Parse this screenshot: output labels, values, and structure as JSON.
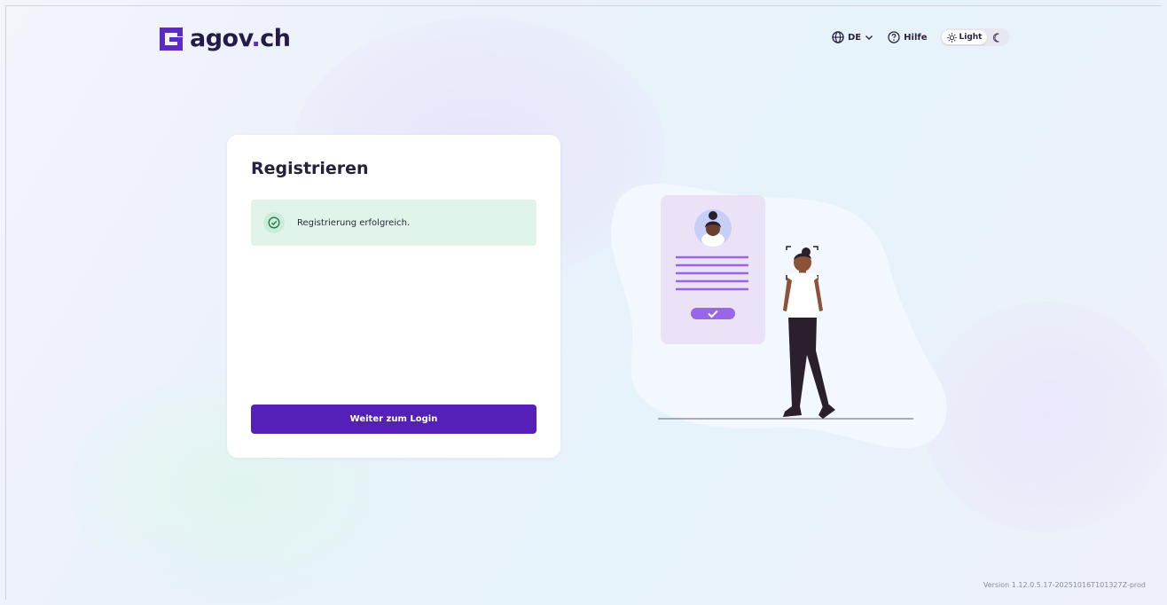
{
  "header": {
    "logo_text_main": "agov",
    "logo_text_dot": ".",
    "logo_text_tld": "ch",
    "language": "DE",
    "help_label": "Hilfe",
    "theme_light_label": "Light"
  },
  "card": {
    "title": "Registrieren",
    "alert_message": "Registrierung erfolgreich.",
    "primary_button": "Weiter zum Login"
  },
  "footer": {
    "version": "Version 1.12.0.5.17-20251016T101327Z-prod"
  },
  "colors": {
    "brand": "#5520b8",
    "logo_dark": "#241b4a",
    "success_bg": "#e1f4ea",
    "success_icon": "#1f7a4a"
  },
  "icons": {
    "logo": "agov-logo-icon",
    "language": "globe-icon",
    "language_dropdown": "chevron-down-icon",
    "help": "help-circle-icon",
    "light": "sun-icon",
    "dark": "moon-icon",
    "alert": "check-circle-icon"
  }
}
